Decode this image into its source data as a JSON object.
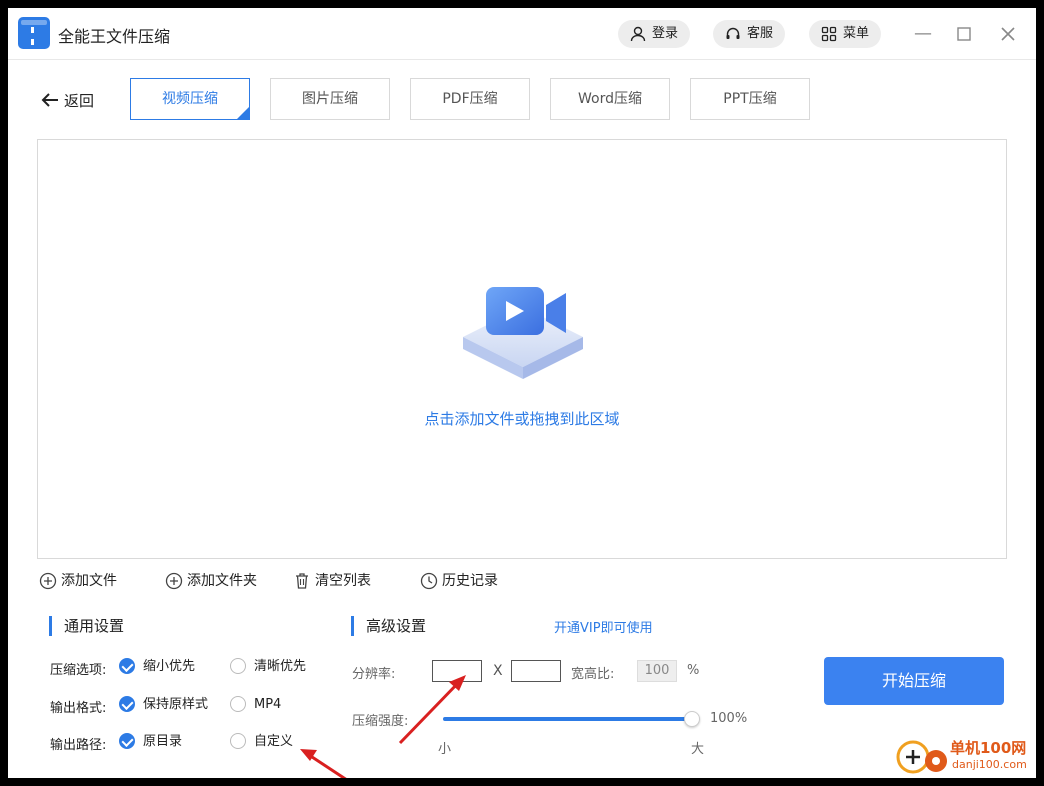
{
  "app": {
    "title": "全能王文件压缩"
  },
  "header": {
    "login": "登录",
    "service": "客服",
    "menu": "菜单"
  },
  "nav": {
    "back": "返回",
    "tabs": [
      {
        "label": "视频压缩",
        "active": true
      },
      {
        "label": "图片压缩",
        "active": false
      },
      {
        "label": "PDF压缩",
        "active": false
      },
      {
        "label": "Word压缩",
        "active": false
      },
      {
        "label": "PPT压缩",
        "active": false
      }
    ]
  },
  "dropzone": {
    "hint": "点击添加文件或拖拽到此区域"
  },
  "actions": {
    "add_file": "添加文件",
    "add_folder": "添加文件夹",
    "clear_list": "清空列表",
    "history": "历史记录"
  },
  "general": {
    "title": "通用设置",
    "compress_label": "压缩选项:",
    "compress_options": [
      "缩小优先",
      "清晰优先"
    ],
    "compress_selected": "缩小优先",
    "format_label": "输出格式:",
    "format_options": [
      "保持原样式",
      "MP4"
    ],
    "format_selected": "保持原样式",
    "path_label": "输出路径:",
    "path_options": [
      "原目录",
      "自定义"
    ],
    "path_selected": "原目录"
  },
  "advanced": {
    "title": "高级设置",
    "vip": "开通VIP即可使用",
    "resolution_label": "分辨率:",
    "resolution_width": "",
    "resolution_height": "",
    "separator": "X",
    "ratio_label": "宽高比:",
    "ratio_value": "100",
    "ratio_unit": "%",
    "strength_label": "压缩强度:",
    "strength_value": "100%",
    "strength_min": "小",
    "strength_max": "大"
  },
  "start_button": "开始压缩",
  "watermark": {
    "brand": "单机100网",
    "url": "danji100.com"
  },
  "colors": {
    "accent": "#2d7be5",
    "button": "#3b82f0",
    "annotation_arrow": "#d92020"
  }
}
